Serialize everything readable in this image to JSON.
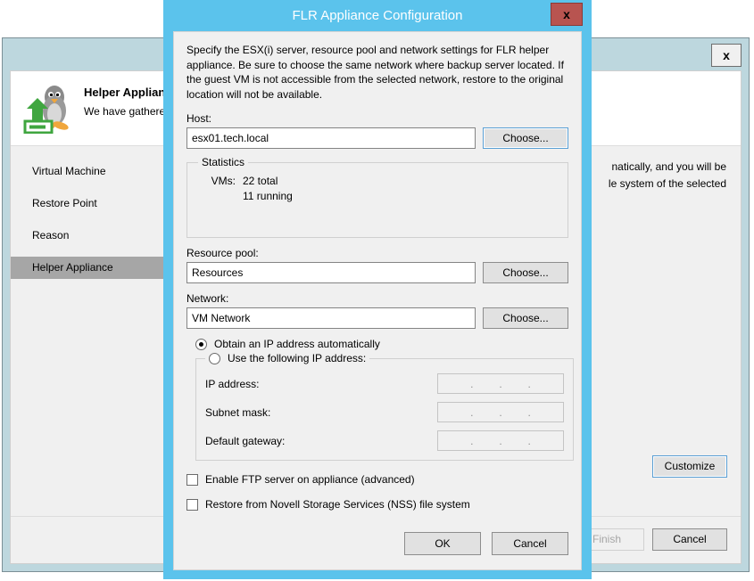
{
  "background_window": {
    "close_label": "x",
    "header": {
      "title": "Helper Applianc",
      "subtitle": "We have gathere",
      "icon": "linux-penguin-upload-icon"
    },
    "sidebar": {
      "items": [
        {
          "label": "Virtual Machine",
          "selected": false
        },
        {
          "label": "Restore Point",
          "selected": false
        },
        {
          "label": "Reason",
          "selected": false
        },
        {
          "label": "Helper Appliance",
          "selected": true
        }
      ]
    },
    "content": {
      "line1": "natically, and you will be",
      "line2": "le system of the selected"
    },
    "customize_label": "Customize",
    "footer": {
      "finish_label": "Finish",
      "cancel_label": "Cancel"
    }
  },
  "modal": {
    "title": "FLR Appliance Configuration",
    "close_label": "x",
    "description": "Specify the ESX(i) server, resource pool and network settings for FLR helper appliance. Be sure to choose the same network where backup server located. If the guest VM is not accessible from the selected network, restore to the original location will not be available.",
    "host": {
      "label": "Host:",
      "value": "esx01.tech.local",
      "choose_label": "Choose..."
    },
    "statistics": {
      "legend": "Statistics",
      "key": "VMs:",
      "total": "22 total",
      "running": "11 running"
    },
    "resource_pool": {
      "label": "Resource pool:",
      "value": "Resources",
      "choose_label": "Choose..."
    },
    "network": {
      "label": "Network:",
      "value": "VM Network",
      "choose_label": "Choose..."
    },
    "ip_mode": {
      "auto_label": "Obtain an IP address automatically",
      "auto_checked": true,
      "manual_label": "Use the following IP address:",
      "manual_checked": false
    },
    "ip_fields": [
      {
        "label": "IP address:",
        "value": ""
      },
      {
        "label": "Subnet mask:",
        "value": ""
      },
      {
        "label": "Default gateway:",
        "value": ""
      }
    ],
    "checkboxes": [
      {
        "label": "Enable FTP server on appliance (advanced)",
        "checked": false
      },
      {
        "label": "Restore from Novell Storage Services (NSS) file system",
        "checked": false
      }
    ],
    "ok_label": "OK",
    "cancel_label": "Cancel"
  },
  "colors": {
    "modal_frame": "#5bc3ec",
    "close_red": "#b85450",
    "bg_frame": "#bdd7de",
    "selection_gray": "#a6a6a6",
    "focus_blue": "#5a9fd4"
  }
}
